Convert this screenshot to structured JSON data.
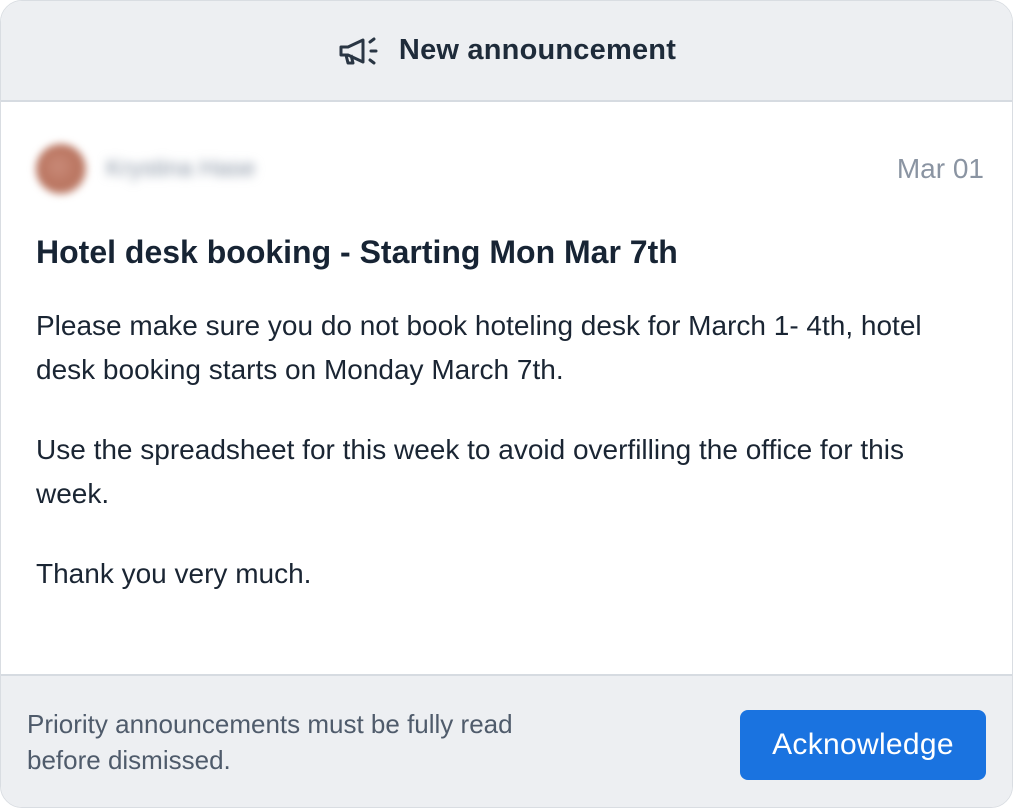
{
  "header": {
    "icon": "megaphone-icon",
    "title": "New announcement"
  },
  "post": {
    "author_name": "Krystina Hase",
    "date": "Mar 01",
    "title": "Hotel desk booking - Starting Mon Mar 7th",
    "paragraphs": [
      "Please make sure you do not book hoteling desk for March 1- 4th, hotel desk booking starts on Monday March 7th.",
      "Use the spreadsheet for this week to avoid overfilling the office for this week.",
      "Thank you very much."
    ]
  },
  "footer": {
    "note": "Priority announcements must be fully read before dismissed.",
    "button_label": "Acknowledge"
  },
  "colors": {
    "accent": "#1a73e0",
    "header_bg": "#edeff2",
    "title_text": "#172434"
  }
}
